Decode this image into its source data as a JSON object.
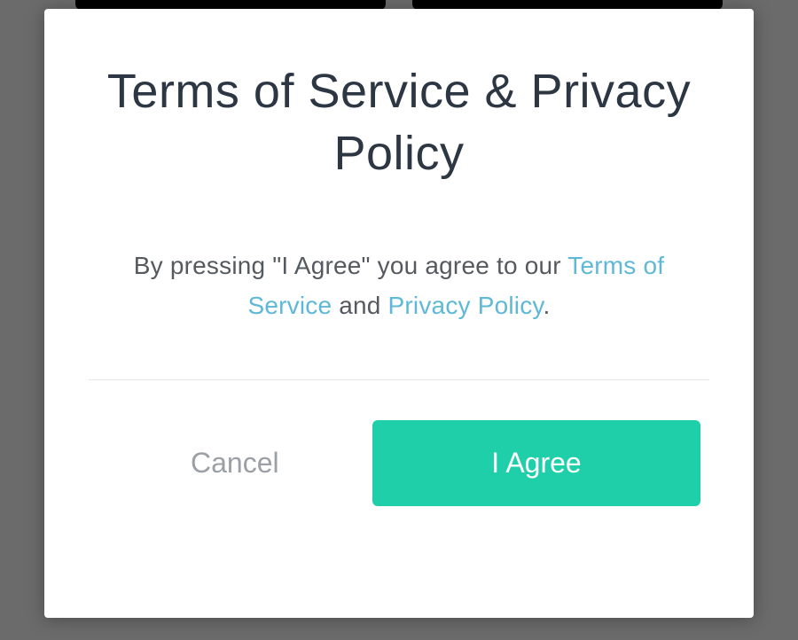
{
  "modal": {
    "title": "Terms of Service & Privacy Policy",
    "body": {
      "prefix": "By pressing \"I Agree\" you agree to our ",
      "tos_link": "Terms of Service",
      "connector": " and ",
      "privacy_link": "Privacy Policy",
      "suffix": "."
    },
    "actions": {
      "cancel_label": "Cancel",
      "agree_label": "I Agree"
    }
  },
  "colors": {
    "accent": "#1fcfa9",
    "link": "#5fb8d6",
    "title": "#2d3743",
    "muted": "#9aa0a6"
  }
}
